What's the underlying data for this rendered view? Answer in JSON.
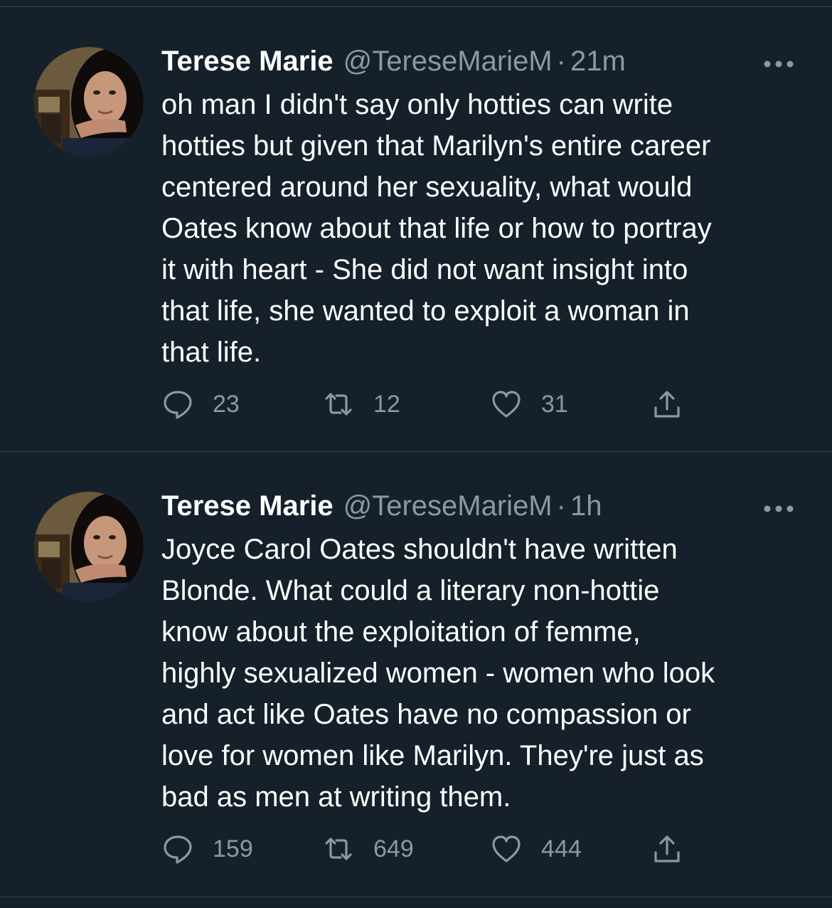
{
  "tweets": [
    {
      "display_name": "Terese Marie",
      "handle": "@TereseMarieM",
      "separator": "·",
      "time": "21m",
      "text": "oh man I didn't say only hotties can write\nhotties but given that Marilyn's entire career\ncentered around her sexuality, what would\nOates know about that life or how to portray\nit with heart - She did not want insight into\nthat life, she wanted to exploit a woman in\nthat life.",
      "replies": "23",
      "retweets": "12",
      "likes": "31"
    },
    {
      "display_name": "Terese Marie",
      "handle": "@TereseMarieM",
      "separator": "·",
      "time": "1h",
      "text": "Joyce Carol Oates shouldn't have written\nBlonde. What could a literary non-hottie\nknow about the exploitation of femme,\nhighly sexualized women - women who look\nand act like Oates have no compassion or\nlove for women like Marilyn. They're just as\nbad as men at writing them.",
      "replies": "159",
      "retweets": "649",
      "likes": "444"
    }
  ],
  "icons": {
    "more": "more-horizontal-icon",
    "reply": "reply-bubble-icon",
    "retweet": "retweet-icon",
    "like": "heart-icon",
    "share": "share-icon"
  },
  "colors": {
    "background": "#15202b",
    "primary_text": "#ffffff",
    "secondary_text": "#8b98a5",
    "divider": "#38444d"
  }
}
